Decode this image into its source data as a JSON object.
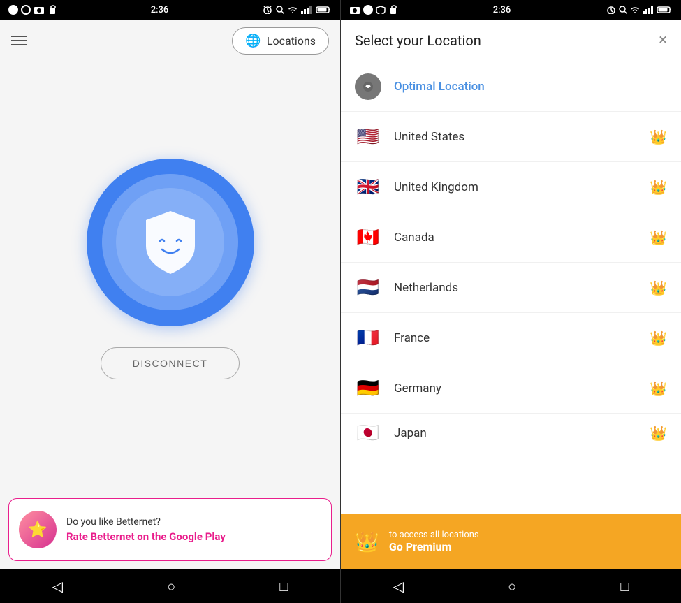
{
  "left": {
    "status": {
      "time": "2:36",
      "icons": [
        "circle",
        "circle-outline",
        "square",
        "bag",
        "alarm",
        "key",
        "wifi",
        "signal",
        "battery"
      ]
    },
    "topBar": {
      "locationsBtn": "Locations"
    },
    "shield": {
      "alt": "Connected shield face"
    },
    "disconnectBtn": "DISCONNECT",
    "banner": {
      "title": "Do you like Betternet?",
      "subtitle": "Rate Betternet on the Google Play",
      "iconEmoji": "⭐"
    },
    "nav": {
      "back": "◁",
      "home": "○",
      "recent": "□"
    }
  },
  "right": {
    "status": {
      "time": "2:36"
    },
    "header": {
      "title": "Select your Location",
      "closeLabel": "×"
    },
    "locations": [
      {
        "id": "optimal",
        "name": "Optimal Location",
        "flag": "🎯",
        "premium": false,
        "special": true
      },
      {
        "id": "us",
        "name": "United States",
        "flag": "🇺🇸",
        "premium": true
      },
      {
        "id": "gb",
        "name": "United Kingdom",
        "flag": "🇬🇧",
        "premium": true
      },
      {
        "id": "ca",
        "name": "Canada",
        "flag": "🇨🇦",
        "premium": true
      },
      {
        "id": "nl",
        "name": "Netherlands",
        "flag": "🇳🇱",
        "premium": true
      },
      {
        "id": "fr",
        "name": "France",
        "flag": "🇫🇷",
        "premium": true
      },
      {
        "id": "de",
        "name": "Germany",
        "flag": "🇩🇪",
        "premium": true
      },
      {
        "id": "jp",
        "name": "Japan",
        "flag": "🇯🇵",
        "premium": true
      }
    ],
    "premiumBanner": {
      "topText": "to access all locations",
      "bottomText": "Go Premium",
      "crownEmoji": "👑"
    },
    "nav": {
      "back": "◁",
      "home": "○",
      "recent": "□"
    }
  },
  "colors": {
    "blue": "#4080f0",
    "pink": "#e91e8c",
    "orange": "#f5a623",
    "optimal": "#4a90e2"
  }
}
